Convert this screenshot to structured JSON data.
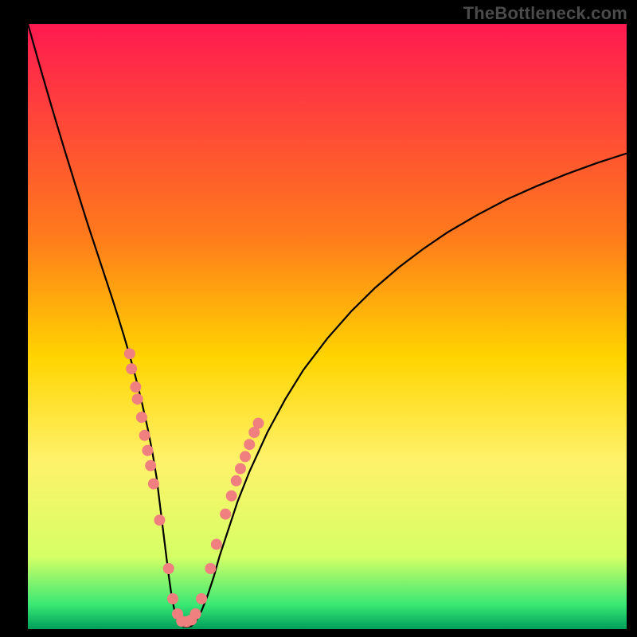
{
  "watermark": "TheBottleneck.com",
  "chart_data": {
    "type": "line",
    "title": "",
    "xlabel": "",
    "ylabel": "",
    "xlim": [
      0,
      100
    ],
    "ylim": [
      0,
      100
    ],
    "gradient_stops": [
      {
        "offset": 0,
        "color": "#ff1a51"
      },
      {
        "offset": 35,
        "color": "#ff7a1c"
      },
      {
        "offset": 55,
        "color": "#ffd400"
      },
      {
        "offset": 72,
        "color": "#fff26a"
      },
      {
        "offset": 88,
        "color": "#d6ff66"
      },
      {
        "offset": 96,
        "color": "#39e874"
      },
      {
        "offset": 100,
        "color": "#009e5a"
      }
    ],
    "series": [
      {
        "name": "curve",
        "type": "line",
        "points": [
          [
            0.0,
            100.0
          ],
          [
            2.0,
            93.0
          ],
          [
            4.0,
            86.2
          ],
          [
            6.0,
            79.6
          ],
          [
            8.0,
            73.2
          ],
          [
            10.0,
            66.9
          ],
          [
            12.0,
            60.9
          ],
          [
            14.0,
            54.9
          ],
          [
            15.0,
            51.8
          ],
          [
            16.0,
            48.6
          ],
          [
            17.0,
            45.2
          ],
          [
            18.0,
            41.6
          ],
          [
            19.0,
            37.6
          ],
          [
            20.0,
            33.2
          ],
          [
            20.8,
            29.2
          ],
          [
            21.5,
            25.0
          ],
          [
            22.0,
            21.0
          ],
          [
            22.5,
            17.0
          ],
          [
            23.0,
            13.0
          ],
          [
            23.5,
            9.0
          ],
          [
            24.0,
            5.5
          ],
          [
            24.5,
            3.0
          ],
          [
            25.0,
            1.3
          ],
          [
            25.7,
            0.5
          ],
          [
            26.5,
            0.3
          ],
          [
            27.3,
            0.5
          ],
          [
            28.0,
            1.2
          ],
          [
            29.0,
            3.0
          ],
          [
            30.0,
            5.5
          ],
          [
            31.0,
            8.5
          ],
          [
            32.0,
            12.0
          ],
          [
            33.5,
            16.5
          ],
          [
            35.0,
            21.0
          ],
          [
            37.0,
            26.0
          ],
          [
            40.0,
            32.5
          ],
          [
            43.0,
            38.0
          ],
          [
            46.0,
            42.8
          ],
          [
            50.0,
            48.0
          ],
          [
            54.0,
            52.5
          ],
          [
            58.0,
            56.4
          ],
          [
            62.0,
            59.8
          ],
          [
            66.0,
            62.8
          ],
          [
            70.0,
            65.5
          ],
          [
            75.0,
            68.4
          ],
          [
            80.0,
            71.0
          ],
          [
            85.0,
            73.2
          ],
          [
            90.0,
            75.2
          ],
          [
            95.0,
            77.0
          ],
          [
            100.0,
            78.6
          ]
        ]
      },
      {
        "name": "markers",
        "type": "scatter",
        "points": [
          [
            17.0,
            45.5
          ],
          [
            17.3,
            43.0
          ],
          [
            18.0,
            40.0
          ],
          [
            18.3,
            38.0
          ],
          [
            19.0,
            35.0
          ],
          [
            19.5,
            32.0
          ],
          [
            20.0,
            29.5
          ],
          [
            20.5,
            27.0
          ],
          [
            21.0,
            24.0
          ],
          [
            22.0,
            18.0
          ],
          [
            23.5,
            10.0
          ],
          [
            24.2,
            5.0
          ],
          [
            25.0,
            2.5
          ],
          [
            25.7,
            1.3
          ],
          [
            26.5,
            1.2
          ],
          [
            27.3,
            1.5
          ],
          [
            28.0,
            2.5
          ],
          [
            29.0,
            5.0
          ],
          [
            30.5,
            10.0
          ],
          [
            31.5,
            14.0
          ],
          [
            33.0,
            19.0
          ],
          [
            34.0,
            22.0
          ],
          [
            34.8,
            24.5
          ],
          [
            35.5,
            26.5
          ],
          [
            36.3,
            28.5
          ],
          [
            37.0,
            30.5
          ],
          [
            37.8,
            32.5
          ],
          [
            38.5,
            34.0
          ]
        ]
      }
    ],
    "marker_color": "#f08080",
    "curve_color": "#000000"
  }
}
